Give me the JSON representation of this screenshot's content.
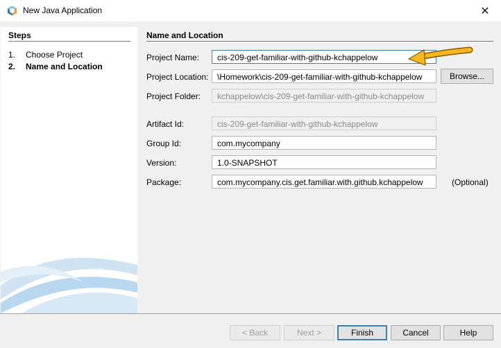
{
  "window": {
    "title": "New Java Application",
    "app_icon": "netbeans-logo-icon",
    "close_icon": "close-icon",
    "close_glyph": "✕"
  },
  "steps": {
    "heading": "Steps",
    "items": [
      {
        "num": "1.",
        "label": "Choose Project"
      },
      {
        "num": "2.",
        "label": "Name and Location"
      }
    ]
  },
  "main": {
    "heading": "Name and Location",
    "fields": {
      "project_name": {
        "label": "Project Name:",
        "value": "cis-209-get-familiar-with-github-kchappelow"
      },
      "project_location": {
        "label": "Project Location:",
        "value": "\\Homework\\cis-209-get-familiar-with-github-kchappelow"
      },
      "project_folder": {
        "label": "Project Folder:",
        "value": "kchappelow\\cis-209-get-familiar-with-github-kchappelow"
      },
      "artifact_id": {
        "label": "Artifact Id:",
        "value": "cis-209-get-familiar-with-github-kchappelow"
      },
      "group_id": {
        "label": "Group Id:",
        "value": "com.mycompany"
      },
      "version": {
        "label": "Version:",
        "value": "1.0-SNAPSHOT"
      },
      "package": {
        "label": "Package:",
        "value": "com.mycompany.cis.get.familiar.with.github.kchappelow",
        "note": "(Optional)"
      }
    },
    "browse_label": "Browse...",
    "annotation": "arrow-pointer-icon",
    "arrow_color": "#f5b820"
  },
  "footer": {
    "back": "< Back",
    "next": "Next >",
    "finish": "Finish",
    "cancel": "Cancel",
    "help": "Help"
  }
}
